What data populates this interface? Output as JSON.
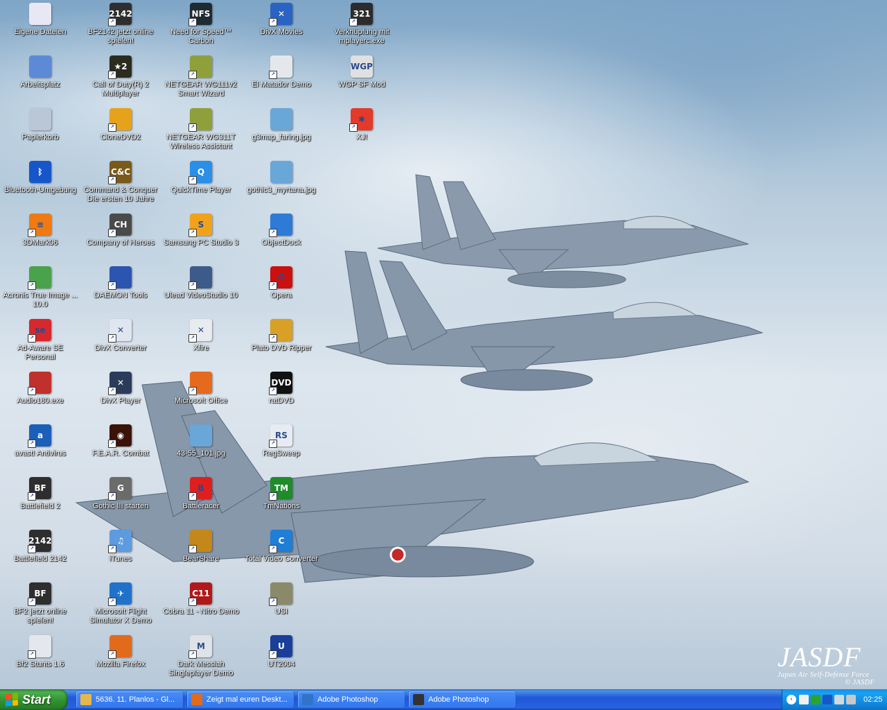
{
  "desktop": {
    "watermark": {
      "main": "JASDF",
      "sub": "Japan Air Self-Defense Force",
      "extra": "© JASDF"
    },
    "columns": [
      [
        {
          "label": "Eigene Dateien",
          "icon": "my-documents-icon",
          "color": "#e8e8f4",
          "text": "",
          "shortcut": false
        },
        {
          "label": "Arbeitsplatz",
          "icon": "my-computer-icon",
          "color": "#5c8ad6",
          "text": "",
          "shortcut": false
        },
        {
          "label": "Papierkorb",
          "icon": "recycle-bin-icon",
          "color": "#b9c7d6",
          "text": "",
          "shortcut": false
        },
        {
          "label": "Bluetooth-Umgebung",
          "icon": "bluetooth-icon",
          "color": "#1656c8",
          "text": "ᛒ",
          "shortcut": false
        },
        {
          "label": "3DMark06",
          "icon": "3dmark-icon",
          "color": "#f07a12",
          "text": "≡",
          "shortcut": true
        },
        {
          "label": "Acronis True Image ... 10.0",
          "icon": "acronis-icon",
          "color": "#4aa34a",
          "text": "",
          "shortcut": true
        },
        {
          "label": "Ad-Aware SE Personal",
          "icon": "ad-aware-icon",
          "color": "#d7282e",
          "text": "se",
          "shortcut": true
        },
        {
          "label": "Audio180.exe",
          "icon": "audio180-icon",
          "color": "#c0302c",
          "text": "",
          "shortcut": true
        },
        {
          "label": "avast! Antivirus",
          "icon": "avast-icon",
          "color": "#1b5fb8",
          "text": "a",
          "shortcut": true
        },
        {
          "label": "Battlefield 2",
          "icon": "battlefield2-icon",
          "color": "#2e2e2e",
          "text": "BF",
          "shortcut": true
        },
        {
          "label": "Battlefield 2142",
          "icon": "battlefield2142-icon",
          "color": "#2e2e2e",
          "text": "2142",
          "shortcut": true
        },
        {
          "label": "BF2 jetzt online spielen!",
          "icon": "bf2-online-icon",
          "color": "#2e2e2e",
          "text": "BF",
          "shortcut": true
        },
        {
          "label": "Bf2 Stunts 1.6",
          "icon": "bf2-stunts-icon",
          "color": "#e4e8ec",
          "text": "",
          "shortcut": true
        }
      ],
      [
        {
          "label": "BF2142 jetzt online spielen!",
          "icon": "bf2142-online-icon",
          "color": "#2e2e2e",
          "text": "2142",
          "shortcut": true
        },
        {
          "label": "Call of Duty(R) 2 Multiplayer",
          "icon": "call-of-duty-icon",
          "color": "#2b2b1e",
          "text": "★2",
          "shortcut": true
        },
        {
          "label": "CloneDVD2",
          "icon": "clonedvd-icon",
          "color": "#e6a21a",
          "text": "",
          "shortcut": true
        },
        {
          "label": "Command & Conquer Die ersten 10 Jahre",
          "icon": "command-conquer-icon",
          "color": "#7a5a1a",
          "text": "C&C",
          "shortcut": true
        },
        {
          "label": "Company of Heroes",
          "icon": "company-of-heroes-icon",
          "color": "#4a4a4a",
          "text": "CH",
          "shortcut": true
        },
        {
          "label": "DAEMON Tools",
          "icon": "daemon-tools-icon",
          "color": "#2b55b0",
          "text": "",
          "shortcut": true
        },
        {
          "label": "DivX Converter",
          "icon": "divx-converter-icon",
          "color": "#dfe6ef",
          "text": "✕",
          "shortcut": true
        },
        {
          "label": "DivX Player",
          "icon": "divx-player-icon",
          "color": "#2b3b5a",
          "text": "✕",
          "shortcut": true
        },
        {
          "label": "F.E.A.R. Combat",
          "icon": "fear-combat-icon",
          "color": "#3a1208",
          "text": "◉",
          "shortcut": true
        },
        {
          "label": "Gothic III starten",
          "icon": "gothic3-icon",
          "color": "#6b6b6b",
          "text": "G",
          "shortcut": true
        },
        {
          "label": "iTunes",
          "icon": "itunes-icon",
          "color": "#5d9be0",
          "text": "♫",
          "shortcut": true
        },
        {
          "label": "Microsoft Flight Simulator X Demo",
          "icon": "flight-simulator-icon",
          "color": "#1f72c9",
          "text": "✈",
          "shortcut": true
        },
        {
          "label": "Mozilla Firefox",
          "icon": "firefox-icon",
          "color": "#e16b1a",
          "text": "",
          "shortcut": true
        }
      ],
      [
        {
          "label": "Need for Speed™ Carbon",
          "icon": "nfs-carbon-icon",
          "color": "#1f2a33",
          "text": "NFS",
          "shortcut": true
        },
        {
          "label": "NETGEAR WG111v2 Smart Wizard",
          "icon": "netgear-wg111-icon",
          "color": "#8fa03a",
          "text": "",
          "shortcut": true
        },
        {
          "label": "NETGEAR WG311T Wireless Assistant",
          "icon": "netgear-wg311-icon",
          "color": "#8fa03a",
          "text": "",
          "shortcut": true
        },
        {
          "label": "QuickTime Player",
          "icon": "quicktime-icon",
          "color": "#2a8fe6",
          "text": "Q",
          "shortcut": true
        },
        {
          "label": "Samsung PC Studio 3",
          "icon": "samsung-pc-studio-icon",
          "color": "#f0a21a",
          "text": "S",
          "shortcut": true
        },
        {
          "label": "Ulead VideoStudio 10",
          "icon": "ulead-videostudio-icon",
          "color": "#3c5a8a",
          "text": "",
          "shortcut": true
        },
        {
          "label": "Xfire",
          "icon": "xfire-icon",
          "color": "#e8ecef",
          "text": "✕",
          "shortcut": true
        },
        {
          "label": "Microsoft Office",
          "icon": "microsoft-office-icon",
          "color": "#e56a1e",
          "text": "",
          "shortcut": true
        },
        {
          "label": "43-55_101.jpg",
          "icon": "image-file-icon",
          "color": "#6aa7d9",
          "text": "",
          "shortcut": false
        },
        {
          "label": "Battleracer",
          "icon": "battleracer-icon",
          "color": "#e11e1e",
          "text": "B",
          "shortcut": true
        },
        {
          "label": "BearShare",
          "icon": "bearshare-icon",
          "color": "#c4881a",
          "text": "",
          "shortcut": true
        },
        {
          "label": "Cobra 11 - Nitro Demo",
          "icon": "cobra11-icon",
          "color": "#b0181a",
          "text": "C11",
          "shortcut": true
        },
        {
          "label": "Dark Messiah Singleplayer Demo",
          "icon": "dark-messiah-icon",
          "color": "#dfe2e6",
          "text": "M",
          "shortcut": true
        }
      ],
      [
        {
          "label": "DivX Movies",
          "icon": "divx-movies-icon",
          "color": "#2a63c4",
          "text": "✕",
          "shortcut": true
        },
        {
          "label": "El Matador Demo",
          "icon": "el-matador-icon",
          "color": "#e4e8ec",
          "text": "",
          "shortcut": true
        },
        {
          "label": "g3map_faring.jpg",
          "icon": "image-file-icon",
          "color": "#6aa7d9",
          "text": "",
          "shortcut": false
        },
        {
          "label": "gothic3_myrtana.jpg",
          "icon": "image-file-icon",
          "color": "#6aa7d9",
          "text": "",
          "shortcut": false
        },
        {
          "label": "ObjectDock",
          "icon": "objectdock-icon",
          "color": "#2d7bd6",
          "text": "",
          "shortcut": true
        },
        {
          "label": "Opera",
          "icon": "opera-icon",
          "color": "#cc1010",
          "text": "O",
          "shortcut": true
        },
        {
          "label": "Plato DVD Ripper",
          "icon": "plato-dvd-ripper-icon",
          "color": "#d8a024",
          "text": "",
          "shortcut": true
        },
        {
          "label": "ratDVD",
          "icon": "ratdvd-icon",
          "color": "#111111",
          "text": "DVD",
          "shortcut": true
        },
        {
          "label": "RegSweep",
          "icon": "regsweep-icon",
          "color": "#e8ecf2",
          "text": "RS",
          "shortcut": true
        },
        {
          "label": "TmNations",
          "icon": "tmnations-icon",
          "color": "#1e8c2a",
          "text": "TM",
          "shortcut": true
        },
        {
          "label": "Total Video Converter",
          "icon": "total-video-converter-icon",
          "color": "#1f7ed6",
          "text": "C",
          "shortcut": true
        },
        {
          "label": "USI",
          "icon": "usi-icon",
          "color": "#8a8a6a",
          "text": "",
          "shortcut": true
        },
        {
          "label": "UT2004",
          "icon": "ut2004-icon",
          "color": "#1a3f9a",
          "text": "U",
          "shortcut": true
        }
      ],
      [
        {
          "label": "Verknüpfung mit mplayerc.exe",
          "icon": "mplayerc-icon",
          "color": "#2c2c2c",
          "text": "321",
          "shortcut": true
        },
        {
          "label": "WGP SF Mod",
          "icon": "wgp-sf-mod-icon",
          "color": "#e0e0e0",
          "text": "WGP",
          "shortcut": false
        },
        {
          "label": "XJ!",
          "icon": "xj-icon",
          "color": "#e33a2a",
          "text": "✱",
          "shortcut": true
        }
      ]
    ]
  },
  "taskbar": {
    "start_label": "Start",
    "tasks": [
      {
        "label": "5636. 11. Planlos - Gl...",
        "icon": "pencil-icon",
        "color": "#e6b84a"
      },
      {
        "label": "Zeigt mal euren Deskt...",
        "icon": "firefox-icon",
        "color": "#e16b1a"
      },
      {
        "label": "Adobe Photoshop",
        "icon": "photoshop-icon",
        "color": "#2f74c6"
      },
      {
        "label": "Adobe Photoshop",
        "icon": "photoshop-icon",
        "color": "#333333"
      }
    ],
    "tray": {
      "icons": [
        {
          "icon": "network-icon",
          "color": "#f0f0f0"
        },
        {
          "icon": "clover-icon",
          "color": "#2aa52a"
        },
        {
          "icon": "bluetooth-tray-icon",
          "color": "#1656c8"
        },
        {
          "icon": "speaker-icon",
          "color": "#d0d8e0"
        },
        {
          "icon": "security-icon",
          "color": "#c8c8c8"
        }
      ],
      "clock": "02:25"
    }
  }
}
